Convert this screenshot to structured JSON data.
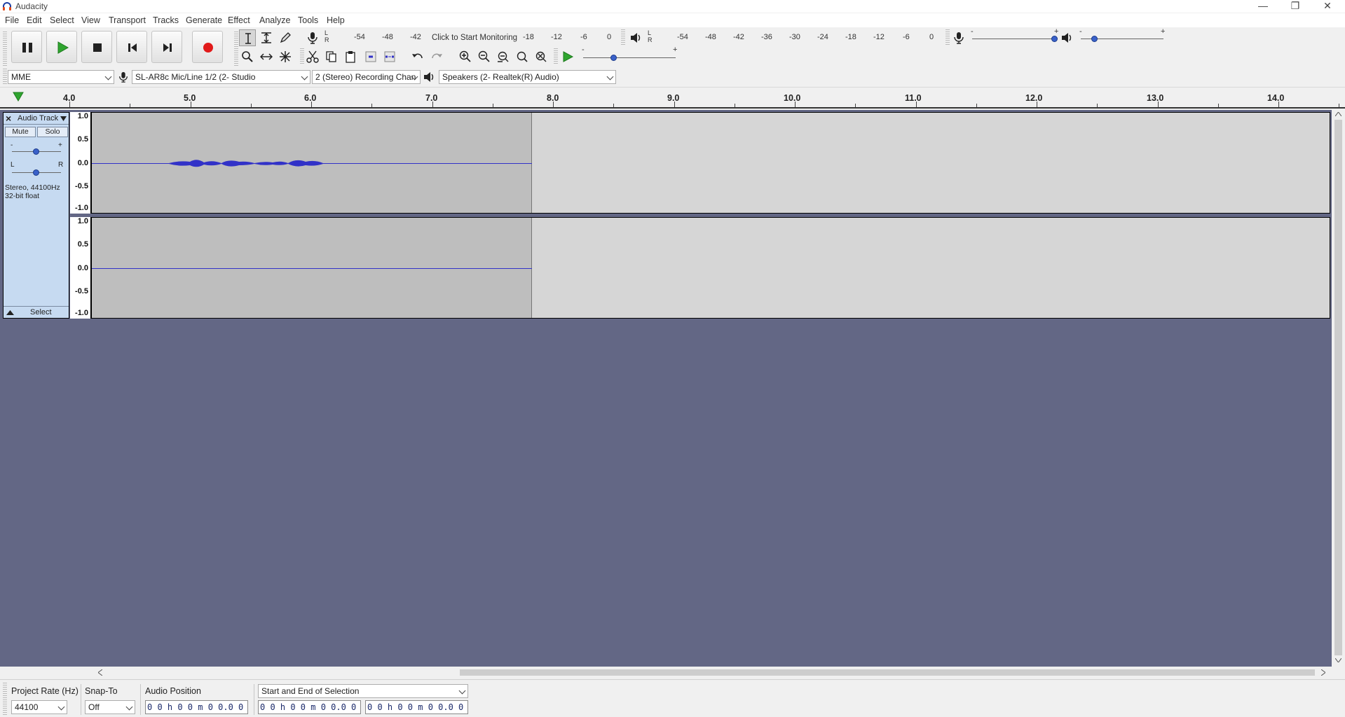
{
  "window": {
    "title": "Audacity",
    "minimize": "—",
    "restore": "❐",
    "close": "✕"
  },
  "menu": [
    "File",
    "Edit",
    "Select",
    "View",
    "Transport",
    "Tracks",
    "Generate",
    "Effect",
    "Analyze",
    "Tools",
    "Help"
  ],
  "record_meter": {
    "channels": "L\nR",
    "left_ticks": [
      "-54",
      "-48",
      "-42"
    ],
    "prompt": "Click to Start Monitoring",
    "right_ticks": [
      "-18",
      "-12",
      "-6",
      "0"
    ]
  },
  "playback_meter": {
    "channels": "L\nR",
    "ticks": [
      "-54",
      "-48",
      "-42",
      "-36",
      "-30",
      "-24",
      "-18",
      "-12",
      "-6",
      "0"
    ]
  },
  "mixer": {
    "minus": "-",
    "plus": "+"
  },
  "speed": {
    "minus": "-",
    "plus": "+"
  },
  "device": {
    "host": "MME",
    "recording_device": "SL-AR8c Mic/Line 1/2 (2- Studio",
    "channels": "2 (Stereo) Recording Chan",
    "playback_device": "Speakers (2- Realtek(R) Audio)"
  },
  "ruler": {
    "labels": [
      "4.0",
      "5.0",
      "6.0",
      "7.0",
      "8.0",
      "9.0",
      "10.0",
      "11.0",
      "12.0",
      "13.0",
      "14.0"
    ]
  },
  "track": {
    "close": "×",
    "name": "Audio Track",
    "mute": "Mute",
    "solo": "Solo",
    "gain_minus": "-",
    "gain_plus": "+",
    "pan_left": "L",
    "pan_right": "R",
    "info_line1": "Stereo, 44100Hz",
    "info_line2": "32-bit float",
    "select": "Select",
    "scale": [
      "1.0",
      "0.5",
      "0.0",
      "-0.5",
      "-1.0"
    ]
  },
  "selection_bar": {
    "project_rate_label": "Project Rate (Hz)",
    "project_rate_value": "44100",
    "snap_to_label": "Snap-To",
    "snap_to_value": "Off",
    "audio_position_label": "Audio Position",
    "audio_position_value": "0 0 h 0 0 m 0 0.0 0 0 s",
    "selection_mode": "Start and End of Selection",
    "selection_start": "0 0 h 0 0 m 0 0.0 0 0 s",
    "selection_end": "0 0 h 0 0 m 0 0.0 0 0 s"
  },
  "colors": {
    "waveform": "#3232c8",
    "track_bg": "#d6d6d6",
    "selected_bg": "#bebebe",
    "track_panel": "#c6daf1",
    "workspace": "#636785",
    "record": "#e11a1a",
    "play": "#2fa52f"
  }
}
